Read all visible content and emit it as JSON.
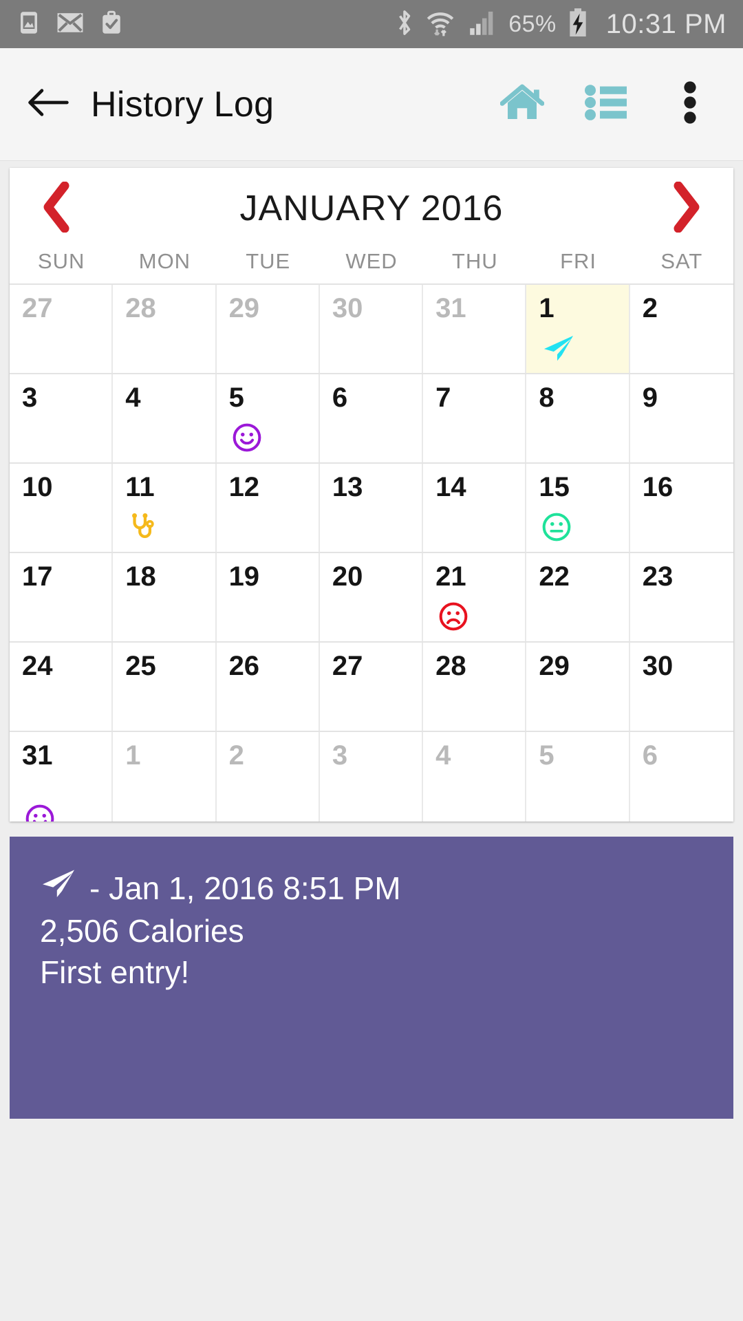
{
  "statusbar": {
    "icons": [
      "image-icon",
      "mail-icon",
      "briefcase-check-icon",
      "bluetooth-icon",
      "wifi-icon",
      "signal-icon"
    ],
    "battery_percent": "65%",
    "battery_state": "charging",
    "time": "10:31 PM"
  },
  "appbar": {
    "back_label": "back-arrow",
    "title": "History Log",
    "actions": [
      {
        "name": "home-icon",
        "color": "#7bc4cc"
      },
      {
        "name": "list-icon",
        "color": "#7bc4cc"
      },
      {
        "name": "overflow-menu-icon",
        "color": "#1c1c1c"
      }
    ]
  },
  "calendar": {
    "month_label": "JANUARY 2016",
    "prev_label": "Previous month",
    "next_label": "Next month",
    "arrow_color": "#d3222a",
    "weekdays": [
      "SUN",
      "MON",
      "TUE",
      "WED",
      "THU",
      "FRI",
      "SAT"
    ],
    "selected_day": 1,
    "selected_bg": "#fdfadf",
    "weeks": [
      [
        {
          "day": "27",
          "out": true,
          "marker": null
        },
        {
          "day": "28",
          "out": true,
          "marker": null
        },
        {
          "day": "29",
          "out": true,
          "marker": null
        },
        {
          "day": "30",
          "out": true,
          "marker": null
        },
        {
          "day": "31",
          "out": true,
          "marker": null
        },
        {
          "day": "1",
          "out": false,
          "marker": "send-plane",
          "selected": true
        },
        {
          "day": "2",
          "out": false,
          "marker": null
        }
      ],
      [
        {
          "day": "3",
          "out": false,
          "marker": null
        },
        {
          "day": "4",
          "out": false,
          "marker": null
        },
        {
          "day": "5",
          "out": false,
          "marker": "face-happy"
        },
        {
          "day": "6",
          "out": false,
          "marker": null
        },
        {
          "day": "7",
          "out": false,
          "marker": null
        },
        {
          "day": "8",
          "out": false,
          "marker": null
        },
        {
          "day": "9",
          "out": false,
          "marker": null
        }
      ],
      [
        {
          "day": "10",
          "out": false,
          "marker": null
        },
        {
          "day": "11",
          "out": false,
          "marker": "stethoscope"
        },
        {
          "day": "12",
          "out": false,
          "marker": null
        },
        {
          "day": "13",
          "out": false,
          "marker": null
        },
        {
          "day": "14",
          "out": false,
          "marker": null
        },
        {
          "day": "15",
          "out": false,
          "marker": "face-neutral"
        },
        {
          "day": "16",
          "out": false,
          "marker": null
        }
      ],
      [
        {
          "day": "17",
          "out": false,
          "marker": null
        },
        {
          "day": "18",
          "out": false,
          "marker": null
        },
        {
          "day": "19",
          "out": false,
          "marker": null
        },
        {
          "day": "20",
          "out": false,
          "marker": null
        },
        {
          "day": "21",
          "out": false,
          "marker": "face-sad"
        },
        {
          "day": "22",
          "out": false,
          "marker": null
        },
        {
          "day": "23",
          "out": false,
          "marker": null
        }
      ],
      [
        {
          "day": "24",
          "out": false,
          "marker": null
        },
        {
          "day": "25",
          "out": false,
          "marker": null
        },
        {
          "day": "26",
          "out": false,
          "marker": null
        },
        {
          "day": "27",
          "out": false,
          "marker": null
        },
        {
          "day": "28",
          "out": false,
          "marker": null
        },
        {
          "day": "29",
          "out": false,
          "marker": null
        },
        {
          "day": "30",
          "out": false,
          "marker": null
        }
      ],
      [
        {
          "day": "31",
          "out": false,
          "marker": "face-happy-clipped"
        },
        {
          "day": "1",
          "out": true,
          "marker": null
        },
        {
          "day": "2",
          "out": true,
          "marker": null
        },
        {
          "day": "3",
          "out": true,
          "marker": null
        },
        {
          "day": "4",
          "out": true,
          "marker": null
        },
        {
          "day": "5",
          "out": true,
          "marker": null
        },
        {
          "day": "6",
          "out": true,
          "marker": null
        }
      ]
    ],
    "marker_colors": {
      "send-plane": "#22e2f2",
      "face-happy": "#9b18d8",
      "stethoscope": "#f5b91b",
      "face-neutral": "#1fe29a",
      "face-sad": "#e8121f"
    }
  },
  "detail": {
    "background": "#615a95",
    "entry_icon": "send-plane-icon",
    "date_text": "- Jan 1, 2016 8:51 PM",
    "calories_text": "2,506 Calories",
    "note_text": "First entry!"
  }
}
